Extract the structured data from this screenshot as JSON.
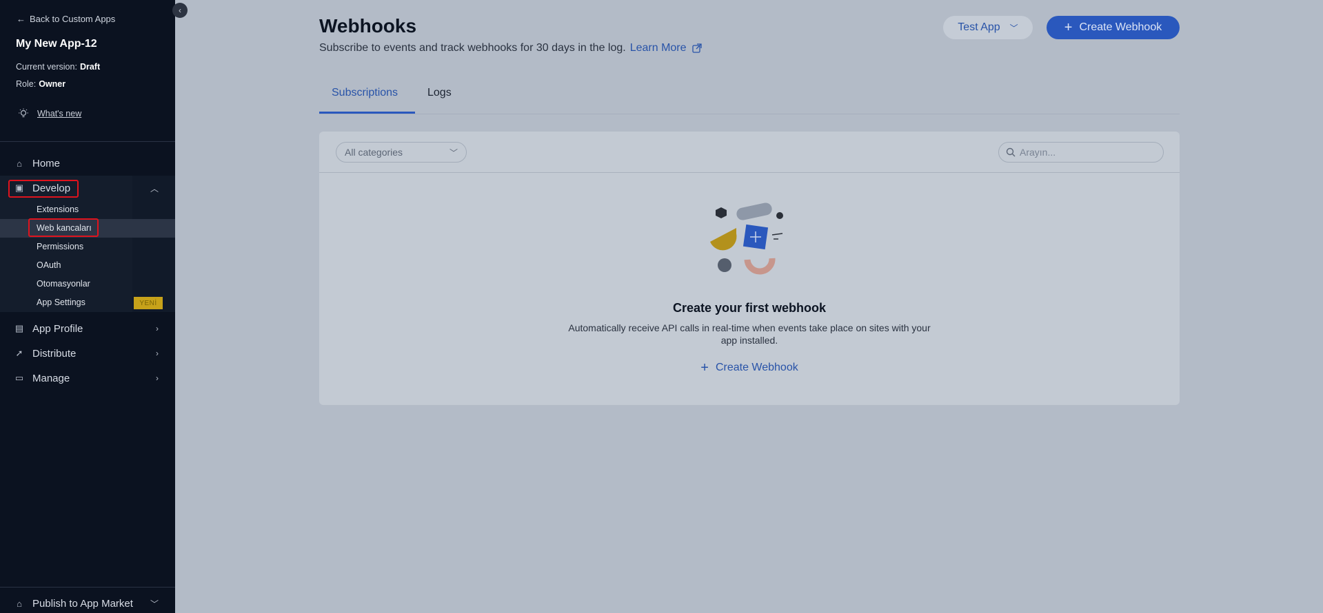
{
  "sidebar": {
    "back_label": "Back to Custom Apps",
    "app_name": "My New App-12",
    "version_label": "Current version:",
    "version_value": "Draft",
    "role_label": "Role:",
    "role_value": "Owner",
    "whats_new": "What's new",
    "nav": {
      "home": "Home",
      "develop": "Develop",
      "app_profile": "App Profile",
      "distribute": "Distribute",
      "manage": "Manage",
      "publish": "Publish to App Market"
    },
    "develop_items": {
      "extensions": "Extensions",
      "webhooks": "Web kancaları",
      "permissions": "Permissions",
      "oauth": "OAuth",
      "automations": "Otomasyonlar",
      "app_settings": "App Settings"
    },
    "new_badge": "YENİ"
  },
  "header": {
    "title": "Webhooks",
    "subtitle": "Subscribe to events and track webhooks for 30 days in the log.",
    "learn_more": "Learn More",
    "app_selector": "Test App",
    "create_button": "Create Webhook"
  },
  "tabs": {
    "subscriptions": "Subscriptions",
    "logs": "Logs"
  },
  "panel": {
    "category_select": "All categories",
    "search_placeholder": "Arayın...",
    "empty_title": "Create your first webhook",
    "empty_desc": "Automatically receive API calls in real-time when events take place on sites with your app installed.",
    "empty_link": "Create Webhook"
  },
  "colors": {
    "sidebar_bg": "#0b1220",
    "overlay_bg": "#b3bbc7",
    "accent": "#2a58bd",
    "highlight": "#e0131d",
    "badge": "#c7a21a"
  }
}
